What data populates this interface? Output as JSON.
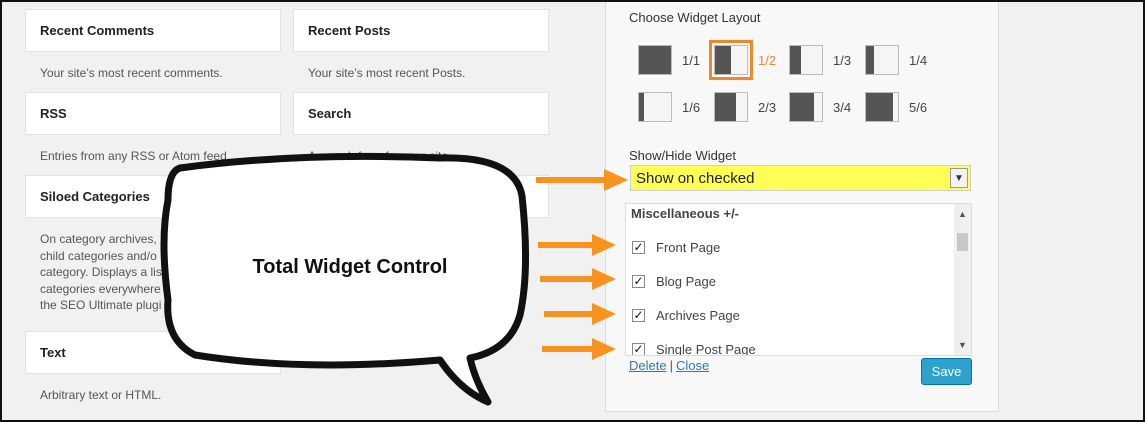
{
  "widgets": [
    {
      "title": "Recent Comments",
      "desc": [
        "Your site’s most recent comments."
      ]
    },
    {
      "title": "Recent Posts",
      "desc": [
        "Your site’s most recent Posts."
      ]
    },
    {
      "title": "RSS",
      "desc": [
        "Entries from any RSS or Atom feed."
      ]
    },
    {
      "title": "Search",
      "desc": [
        "A search form for your site."
      ]
    },
    {
      "title": "Siloed Categories",
      "desc": [
        "On category archives,",
        "child categories and/o",
        "category. Displays a lis",
        "categories everywhere",
        "the SEO Ultimate plugi"
      ]
    },
    {
      "title": "Text",
      "desc": [
        "Arbitrary text or HTML."
      ]
    }
  ],
  "panel": {
    "layout_title": "Choose Widget Layout",
    "layouts": [
      {
        "label": "1/1",
        "fill": 1.0,
        "selected": false
      },
      {
        "label": "1/2",
        "fill": 0.5,
        "selected": true
      },
      {
        "label": "1/3",
        "fill": 0.3333,
        "selected": false
      },
      {
        "label": "1/4",
        "fill": 0.25,
        "selected": false
      },
      {
        "label": "1/6",
        "fill": 0.1667,
        "selected": false
      },
      {
        "label": "2/3",
        "fill": 0.6667,
        "selected": false
      },
      {
        "label": "3/4",
        "fill": 0.75,
        "selected": false
      },
      {
        "label": "5/6",
        "fill": 0.8333,
        "selected": false
      }
    ],
    "showhide_title": "Show/Hide Widget",
    "showhide_value": "Show on checked",
    "checklist_heading": "Miscellaneous +/-",
    "checklist": [
      {
        "label": "Front Page",
        "checked": true
      },
      {
        "label": "Blog Page",
        "checked": true
      },
      {
        "label": "Archives Page",
        "checked": true
      },
      {
        "label": "Single Post Page",
        "checked": true
      }
    ],
    "delete_label": "Delete",
    "separator": "|",
    "close_label": "Close",
    "save_label": "Save"
  },
  "callout": {
    "text": "Total Widget Control"
  },
  "colors": {
    "accent_orange": "#e98a2c",
    "highlight_yellow": "#ffff55",
    "save_blue": "#2ea2cc",
    "link_blue": "#2a7ab8"
  }
}
